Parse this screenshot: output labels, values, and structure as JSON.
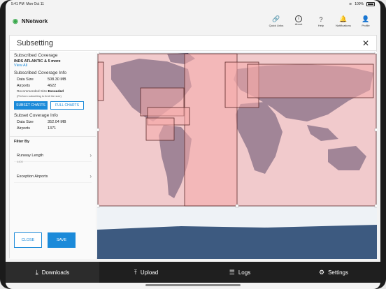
{
  "status": {
    "time": "5:41 PM",
    "date": "Mon Oct 11",
    "battery": "100%"
  },
  "app": {
    "name": "NNetwork"
  },
  "toolbar": [
    {
      "label": "Quick Links",
      "icon": "link-icon",
      "glyph": "🔗"
    },
    {
      "label": "About",
      "icon": "info-icon",
      "glyph": "i"
    },
    {
      "label": "Help",
      "icon": "help-icon",
      "glyph": "?"
    },
    {
      "label": "Notifications",
      "icon": "bell-icon",
      "glyph": "🔔"
    },
    {
      "label": "Profile",
      "icon": "profile-icon",
      "glyph": "👤"
    }
  ],
  "panel": {
    "title": "Subsetting",
    "close": "✕"
  },
  "subscribed_coverage": {
    "heading": "Subscribed Coverage",
    "value": "INDS ATLANTIC & 5 more",
    "view_all": "View All"
  },
  "subscribed_info": {
    "heading": "Subscribed Coverage Info",
    "data_size_label": "Data Size",
    "data_size": "508.30 MB",
    "airports_label": "Airports",
    "airports": "4622"
  },
  "recommended": {
    "label": "Recommended Size",
    "status": "Exceeded",
    "note": "(Perform subsetting to limit the size)"
  },
  "chart_buttons": {
    "subset": "SUBSET CHARTS",
    "full": "FULL CHARTS"
  },
  "subset_info": {
    "heading": "Subset Coverage Info",
    "data_size_label": "Data Size",
    "data_size": "352.04 MB",
    "airports_label": "Airports",
    "airports": "1371"
  },
  "filter": {
    "heading": "Filter By",
    "runway_label": "Runway Length",
    "runway_hint": "4400",
    "exception_label": "Exception Airports"
  },
  "actions": {
    "close": "CLOSE",
    "save": "SAVE"
  },
  "tabs": [
    {
      "label": "Downloads",
      "icon": "download-icon",
      "glyph": "⤓"
    },
    {
      "label": "Upload",
      "icon": "upload-icon",
      "glyph": "⤒"
    },
    {
      "label": "Logs",
      "icon": "list-icon",
      "glyph": "☰"
    },
    {
      "label": "Settings",
      "icon": "gear-icon",
      "glyph": "⚙"
    }
  ],
  "colors": {
    "accent": "#1b8ad9",
    "brand": "#37a84a",
    "region_fill": "#f4aaaa",
    "region_stroke": "#5c2a2a",
    "ocean": "#eef2f6",
    "land": "#3d5a80"
  }
}
